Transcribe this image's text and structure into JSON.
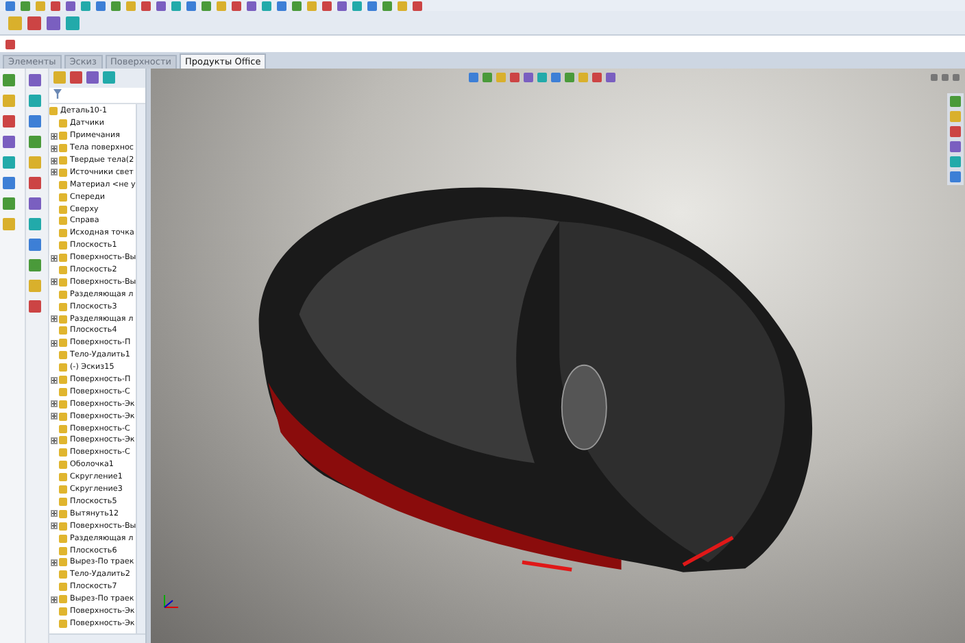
{
  "tabs": [
    {
      "label": "Элементы",
      "selected": false
    },
    {
      "label": "Эскиз",
      "selected": false
    },
    {
      "label": "Поверхности",
      "selected": false
    },
    {
      "label": "Продукты Office",
      "selected": true
    }
  ],
  "feature_tree": {
    "label": "Деталь10-1",
    "children": [
      {
        "label": "Датчики",
        "collapsed": false
      },
      {
        "label": "Примечания",
        "collapsed": true
      },
      {
        "label": "Тела поверхнос",
        "collapsed": true
      },
      {
        "label": "Твердые тела(2",
        "collapsed": true
      },
      {
        "label": "Источники свет",
        "collapsed": true
      },
      {
        "label": "Материал <не у",
        "collapsed": false
      },
      {
        "label": "Спереди",
        "collapsed": false
      },
      {
        "label": "Сверху",
        "collapsed": false
      },
      {
        "label": "Справа",
        "collapsed": false
      },
      {
        "label": "Исходная точка",
        "collapsed": false
      },
      {
        "label": "Плоскость1",
        "collapsed": false
      },
      {
        "label": "Поверхность-Вы",
        "collapsed": true
      },
      {
        "label": "Плоскость2",
        "collapsed": false
      },
      {
        "label": "Поверхность-Вы",
        "collapsed": true
      },
      {
        "label": "Разделяющая л",
        "collapsed": false
      },
      {
        "label": "Плоскость3",
        "collapsed": false
      },
      {
        "label": "Разделяющая л",
        "collapsed": true
      },
      {
        "label": "Плоскость4",
        "collapsed": false
      },
      {
        "label": "Поверхность-П",
        "collapsed": true
      },
      {
        "label": "Тело-Удалить1",
        "collapsed": false
      },
      {
        "label": "(-) Эскиз15",
        "collapsed": false
      },
      {
        "label": "Поверхность-П",
        "collapsed": true
      },
      {
        "label": "Поверхность-С",
        "collapsed": false
      },
      {
        "label": "Поверхность-Эк",
        "collapsed": true
      },
      {
        "label": "Поверхность-Эк",
        "collapsed": true
      },
      {
        "label": "Поверхность-С",
        "collapsed": false
      },
      {
        "label": "Поверхность-Эк",
        "collapsed": true
      },
      {
        "label": "Поверхность-С",
        "collapsed": false
      },
      {
        "label": "Оболочка1",
        "collapsed": false
      },
      {
        "label": "Скругление1",
        "collapsed": false
      },
      {
        "label": "Скругление3",
        "collapsed": false
      },
      {
        "label": "Плоскость5",
        "collapsed": false
      },
      {
        "label": "Вытянуть12",
        "collapsed": true
      },
      {
        "label": "Поверхность-Вы",
        "collapsed": true
      },
      {
        "label": "Разделяющая л",
        "collapsed": false
      },
      {
        "label": "Плоскость6",
        "collapsed": false
      },
      {
        "label": "Вырез-По траек",
        "collapsed": true
      },
      {
        "label": "Тело-Удалить2",
        "collapsed": false
      },
      {
        "label": "Плоскость7",
        "collapsed": false
      },
      {
        "label": "Вырез-По траек",
        "collapsed": true
      },
      {
        "label": "Поверхность-Эк",
        "collapsed": false
      },
      {
        "label": "Поверхность-Эк",
        "collapsed": false
      }
    ]
  }
}
